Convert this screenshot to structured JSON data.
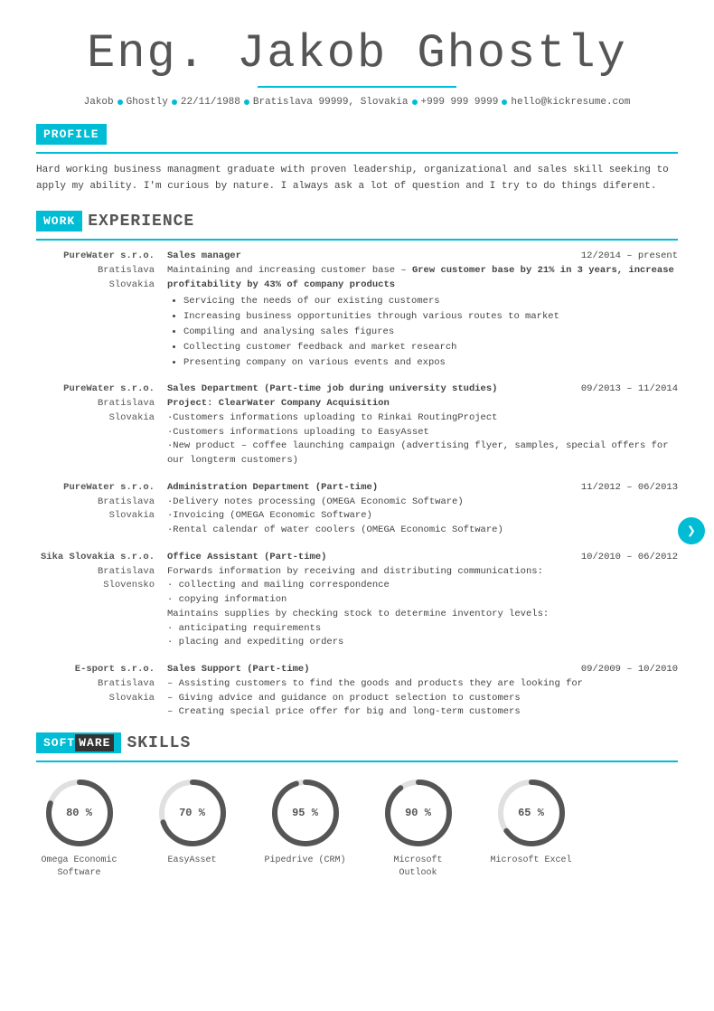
{
  "header": {
    "title": "Eng. Jakob Ghostly",
    "contact": {
      "name": "Jakob",
      "surname": "Ghostly",
      "dob": "22/11/1988",
      "location": "Bratislava 99999, Slovakia",
      "phone": "+999 999 9999",
      "email": "hello@kickresume.com"
    }
  },
  "profile": {
    "section_tag": "PROFILE",
    "text": "Hard working business managment graduate with proven leadership, organizational and sales skill seeking to apply my ability. I'm curious by nature. I always ask a lot of question and I try to do things diferent."
  },
  "work": {
    "section_tag": "WORK",
    "section_title": "EXPERIENCE",
    "entries": [
      {
        "company": "PureWater s.r.o.",
        "city": "Bratislava",
        "country": "Slovakia",
        "title": "Sales manager",
        "date": "12/2014 – present",
        "description": "Maintaining and increasing customer base – Grew customer base by 21% in 3 years, increase profitability by 43% of company products",
        "bullets": [
          "Servicing the needs of our existing customers",
          "Increasing business opportunities through various routes to market",
          "Compiling and analysing sales figures",
          "Collecting customer feedback and market research",
          "Presenting company on various events and expos"
        ],
        "extra": null
      },
      {
        "company": "PureWater s.r.o.",
        "city": "Bratislava",
        "country": "Slovakia",
        "title": "Sales Department (Part-time job during university studies)",
        "date": "09/2013 – 11/2014",
        "project": "Project: ClearWater Company Acquisition",
        "bullets_dash": [
          "·Customers informations uploading to Rinkai RoutingProject",
          "·Customers informations uploading to EasyAsset",
          "·New product – coffee launching campaign (advertising flyer, samples, special offers for our longterm customers)"
        ],
        "extra": null
      },
      {
        "company": "PureWater s.r.o.",
        "city": "Bratislava",
        "country": "Slovakia",
        "title": "Administration Department (Part-time)",
        "date": "11/2012 – 06/2013",
        "bullets_dash": [
          "·Delivery notes processing (OMEGA Economic Software)",
          "·Invoicing (OMEGA Economic Software)",
          "·Rental calendar of water coolers (OMEGA Economic Software)"
        ],
        "extra": null,
        "show_next": true
      },
      {
        "company": "Sika Slovakia s.r.o.",
        "city": "Bratislava",
        "country": "Slovensko",
        "title": "Office Assistant (Part-time)",
        "date": "10/2010 – 06/2012",
        "desc_parts": [
          "Forwards information by receiving and distributing communications:",
          "· collecting and mailing correspondence",
          "· copying information",
          "Maintains supplies by checking stock to determine inventory levels:",
          "· anticipating requirements",
          "· placing and expediting orders"
        ],
        "extra": null
      },
      {
        "company": "E-sport s.r.o.",
        "city": "Bratislava",
        "country": "Slovakia",
        "title": "Sales Support (Part-time)",
        "date": "09/2009 – 10/2010",
        "desc_parts": [
          "– Assisting customers to find the goods and products they are looking for",
          "– Giving advice and guidance on product selection to customers",
          "– Creating special price offer for big and long-term customers"
        ],
        "extra": null
      }
    ]
  },
  "skills": {
    "section_tag": "SOFT",
    "section_tag2": "WARE",
    "section_title": "SKILLS",
    "items": [
      {
        "name": "Omega Economic\nSoftware",
        "pct": 80
      },
      {
        "name": "EasyAsset",
        "pct": 70
      },
      {
        "name": "Pipedrive (CRM)",
        "pct": 95
      },
      {
        "name": "Microsoft Outlook",
        "pct": 90
      },
      {
        "name": "Microsoft Excel",
        "pct": 65
      }
    ]
  }
}
